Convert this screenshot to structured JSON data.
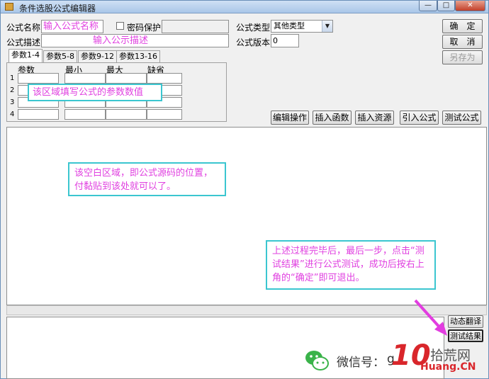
{
  "window": {
    "title": "条件选股公式编辑器",
    "min": "—",
    "max": "□",
    "close": "✕"
  },
  "form": {
    "name_label": "公式名称",
    "name_value": "输入公式名称",
    "password_label": "密码保护",
    "password_value": "",
    "type_label": "公式类型",
    "type_value": "其他类型",
    "desc_label": "公式描述",
    "desc_value": "输入公示描述",
    "version_label": "公式版本",
    "version_value": "0"
  },
  "side_buttons": {
    "ok": "确　定",
    "cancel": "取　消",
    "save_as": "另存为"
  },
  "tabs": [
    "参数1-4",
    "参数5-8",
    "参数9-12",
    "参数13-16"
  ],
  "param_table": {
    "headers": [
      "参数",
      "最小",
      "最大",
      "缺省"
    ],
    "rows": [
      "1",
      "2",
      "3",
      "4"
    ]
  },
  "toolbar": {
    "edit_op": "编辑操作",
    "insert_func": "插入函数",
    "insert_res": "插入资源",
    "import": "引入公式",
    "test": "测试公式"
  },
  "notes": {
    "param": "该区域填写公式的参数数值",
    "editor": "该空白区域，即公式源码的位置，付黏贴到该处就可以了。",
    "steps": "上述过程完毕后，最后一步，点击“测试结果”进行公式测试，成功后按右上角的“确定”即可退出。"
  },
  "bottom_buttons": {
    "dynamic": "动态翻译",
    "result": "测试结果"
  },
  "watermark": {
    "wechat": "微信号：",
    "handle": "g",
    "brand_cn": "拾荒网",
    "brand_en": "Huang.CN",
    "logo_digits": "10"
  },
  "colors": {
    "annotation_border": "#3bc6d0",
    "annotation_text": "#e040e0",
    "arrow": "#e23de0"
  }
}
